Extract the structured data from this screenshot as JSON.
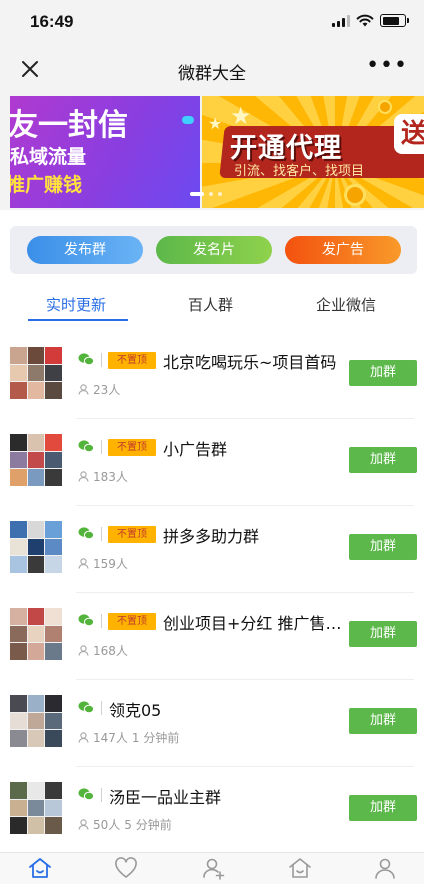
{
  "status_bar": {
    "time": "16:49"
  },
  "nav": {
    "title": "微群大全"
  },
  "banner": {
    "slide_a": {
      "line1": "友一封信",
      "line2": "私域流量",
      "line3": "推广赚钱"
    },
    "slide_b": {
      "title": "开通代理",
      "subtitle": "引流、找客户、找项目",
      "badge": "送"
    }
  },
  "actions": {
    "publish_group": "发布群",
    "publish_card": "发名片",
    "publish_ad": "发广告"
  },
  "tabs": [
    {
      "label": "实时更新",
      "active": true
    },
    {
      "label": "百人群",
      "active": false
    },
    {
      "label": "企业微信",
      "active": false
    }
  ],
  "groups": [
    {
      "name": "北京吃喝玩乐~项目首码",
      "badge": "不置顶",
      "members": "23人",
      "time": "",
      "button": "加群"
    },
    {
      "name": "小广告群",
      "badge": "不置顶",
      "members": "183人",
      "time": "",
      "button": "加群"
    },
    {
      "name": "拼多多助力群",
      "badge": "不置顶",
      "members": "159人",
      "time": "",
      "button": "加群"
    },
    {
      "name": "创业项目+分红 推广售…",
      "badge": "不置顶",
      "members": "168人",
      "time": "",
      "button": "加群"
    },
    {
      "name": "领克05",
      "badge": "",
      "members": "147人",
      "time": "1 分钟前",
      "button": "加群"
    },
    {
      "name": "汤臣一品业主群",
      "badge": "",
      "members": "50人",
      "time": "5 分钟前",
      "button": "加群"
    }
  ],
  "bottom_tabs": [
    "home-icon",
    "heart-icon",
    "add-user-icon",
    "house-icon",
    "person-icon"
  ],
  "colors": {
    "accent_blue": "#2a6ee6",
    "join_green": "#5cb84a",
    "badge_yellow": "#ffb300"
  }
}
